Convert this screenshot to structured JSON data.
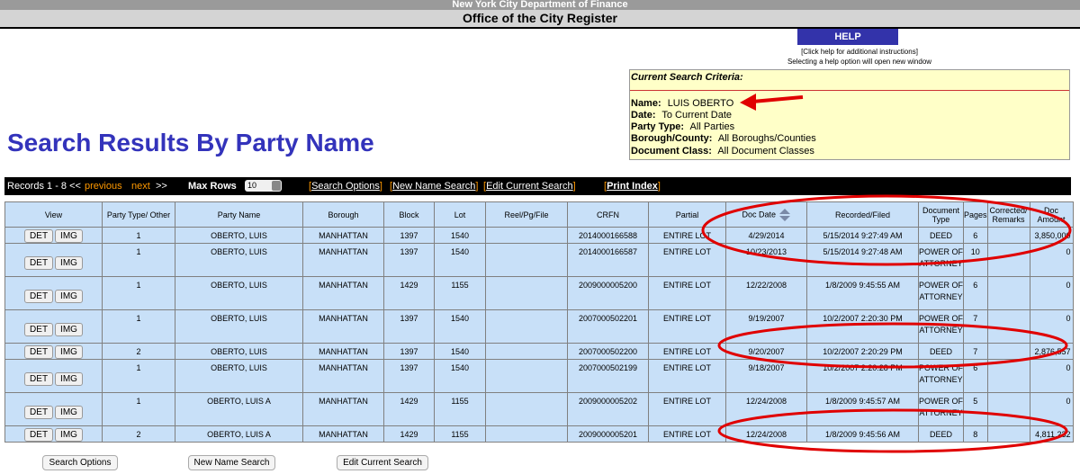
{
  "header": {
    "agency": "New York City Department of Finance",
    "office": "Office of the City Register"
  },
  "help": {
    "button_label": "HELP",
    "note1": "[Click help for additional instructions]",
    "note2": "Selecting a help option will open new window"
  },
  "criteria": {
    "title": "Current Search Criteria:",
    "rows": [
      {
        "label": "Name:",
        "value": "LUIS OBERTO"
      },
      {
        "label": "Date:",
        "value": "To Current Date"
      },
      {
        "label": "Party Type:",
        "value": "All Parties"
      },
      {
        "label": "Borough/County:",
        "value": "All Boroughs/Counties"
      },
      {
        "label": "Document Class:",
        "value": "All Document Classes"
      }
    ]
  },
  "page_title": "Search Results By Party Name",
  "toolbar": {
    "records": "Records 1 - 8 <<",
    "previous": "previous",
    "next": "next",
    "next_arrows": ">>",
    "max_rows_label": "Max Rows",
    "max_rows_value": "10",
    "search_options": "Search Options",
    "new_name_search": "New Name Search",
    "edit_current_search": "Edit Current Search",
    "print_index": "Print Index"
  },
  "columns": [
    "View",
    "Party Type/ Other",
    "Party Name",
    "Borough",
    "Block",
    "Lot",
    "Reel/Pg/File",
    "CRFN",
    "Partial",
    "Doc Date",
    "Recorded/Filed",
    "Document Type",
    "Pages",
    "Corrected/ Remarks",
    "Doc Amount"
  ],
  "view_buttons": {
    "det": "DET",
    "img": "IMG"
  },
  "rows": [
    {
      "party_type": "1",
      "party_name": "OBERTO, LUIS",
      "borough": "MANHATTAN",
      "block": "1397",
      "lot": "1540",
      "reel": "",
      "crfn": "2014000166588",
      "partial": "ENTIRE LOT",
      "doc_date": "4/29/2014",
      "recorded": "5/15/2014 9:27:49 AM",
      "doc_type": "DEED",
      "pages": "6",
      "remarks": "",
      "amount": "3,850,000"
    },
    {
      "party_type": "1",
      "party_name": "OBERTO, LUIS",
      "borough": "MANHATTAN",
      "block": "1397",
      "lot": "1540",
      "reel": "",
      "crfn": "2014000166587",
      "partial": "ENTIRE LOT",
      "doc_date": "10/23/2013",
      "recorded": "5/15/2014 9:27:48 AM",
      "doc_type": "POWER OF ATTORNEY",
      "pages": "10",
      "remarks": "",
      "amount": "0"
    },
    {
      "party_type": "1",
      "party_name": "OBERTO, LUIS",
      "borough": "MANHATTAN",
      "block": "1429",
      "lot": "1155",
      "reel": "",
      "crfn": "2009000005200",
      "partial": "ENTIRE LOT",
      "doc_date": "12/22/2008",
      "recorded": "1/8/2009 9:45:55 AM",
      "doc_type": "POWER OF ATTORNEY",
      "pages": "6",
      "remarks": "",
      "amount": "0"
    },
    {
      "party_type": "1",
      "party_name": "OBERTO, LUIS",
      "borough": "MANHATTAN",
      "block": "1397",
      "lot": "1540",
      "reel": "",
      "crfn": "2007000502201",
      "partial": "ENTIRE LOT",
      "doc_date": "9/19/2007",
      "recorded": "10/2/2007 2:20:30 PM",
      "doc_type": "POWER OF ATTORNEY",
      "pages": "7",
      "remarks": "",
      "amount": "0"
    },
    {
      "party_type": "2",
      "party_name": "OBERTO, LUIS",
      "borough": "MANHATTAN",
      "block": "1397",
      "lot": "1540",
      "reel": "",
      "crfn": "2007000502200",
      "partial": "ENTIRE LOT",
      "doc_date": "9/20/2007",
      "recorded": "10/2/2007 2:20:29 PM",
      "doc_type": "DEED",
      "pages": "7",
      "remarks": "",
      "amount": "2,876,557"
    },
    {
      "party_type": "1",
      "party_name": "OBERTO, LUIS",
      "borough": "MANHATTAN",
      "block": "1397",
      "lot": "1540",
      "reel": "",
      "crfn": "2007000502199",
      "partial": "ENTIRE LOT",
      "doc_date": "9/18/2007",
      "recorded": "10/2/2007 2:20:28 PM",
      "doc_type": "POWER OF ATTORNEY",
      "pages": "6",
      "remarks": "",
      "amount": "0"
    },
    {
      "party_type": "1",
      "party_name": "OBERTO, LUIS A",
      "borough": "MANHATTAN",
      "block": "1429",
      "lot": "1155",
      "reel": "",
      "crfn": "2009000005202",
      "partial": "ENTIRE LOT",
      "doc_date": "12/24/2008",
      "recorded": "1/8/2009 9:45:57 AM",
      "doc_type": "POWER OF ATTORNEY",
      "pages": "5",
      "remarks": "",
      "amount": "0"
    },
    {
      "party_type": "2",
      "party_name": "OBERTO, LUIS A",
      "borough": "MANHATTAN",
      "block": "1429",
      "lot": "1155",
      "reel": "",
      "crfn": "2009000005201",
      "partial": "ENTIRE LOT",
      "doc_date": "12/24/2008",
      "recorded": "1/8/2009 9:45:56 AM",
      "doc_type": "DEED",
      "pages": "8",
      "remarks": "",
      "amount": "4,811,232"
    }
  ],
  "bottom_buttons": {
    "search_options": "Search Options",
    "new_name_search": "New Name Search",
    "edit_current_search": "Edit Current Search"
  },
  "colors": {
    "title_blue": "#3333bb",
    "table_bg": "#c8e0f8",
    "criteria_bg": "#ffffc8",
    "annotation_red": "#e00000",
    "link_orange": "#ff9900"
  }
}
